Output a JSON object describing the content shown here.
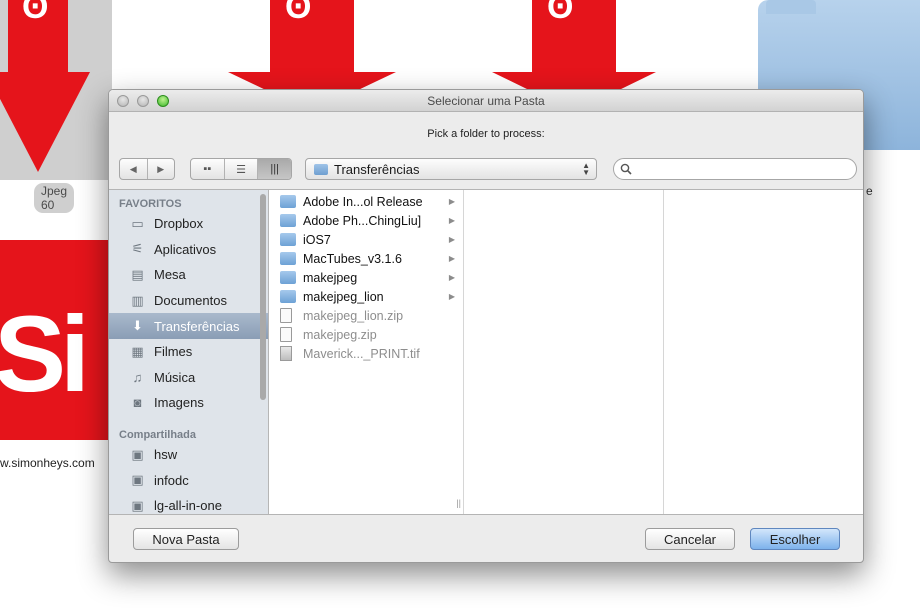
{
  "background": {
    "badge": "Jpeg 60",
    "url": "w.simonheys.com",
    "tile_text": "Si",
    "arrow_glyph": "ʘ",
    "stray_text": "e"
  },
  "dialog": {
    "title": "Selecionar uma Pasta",
    "prompt": "Pick a folder to process:",
    "path_popup": "Transferências",
    "search": {
      "value": "",
      "placeholder": ""
    },
    "view_buttons": [
      "icon-view",
      "list-view",
      "column-view"
    ],
    "sidebar": {
      "favorites_header": "FAVORITOS",
      "favorites": [
        {
          "label": "Dropbox",
          "icon": "folder-icon"
        },
        {
          "label": "Aplicativos",
          "icon": "applications-icon"
        },
        {
          "label": "Mesa",
          "icon": "desktop-icon"
        },
        {
          "label": "Documentos",
          "icon": "documents-icon"
        },
        {
          "label": "Transferências",
          "icon": "downloads-icon",
          "selected": true
        },
        {
          "label": "Filmes",
          "icon": "movies-icon"
        },
        {
          "label": "Música",
          "icon": "music-icon"
        },
        {
          "label": "Imagens",
          "icon": "pictures-icon"
        }
      ],
      "shared_header": "Compartilhada",
      "shared": [
        {
          "label": "hsw",
          "icon": "network-computer-icon"
        },
        {
          "label": "infodc",
          "icon": "network-computer-icon"
        },
        {
          "label": "lg-all-in-one",
          "icon": "network-computer-icon"
        }
      ]
    },
    "files": [
      {
        "name": "Adobe In...ol Release",
        "kind": "folder",
        "enabled": true
      },
      {
        "name": "Adobe Ph...ChingLiu]",
        "kind": "folder",
        "enabled": true
      },
      {
        "name": "iOS7",
        "kind": "folder",
        "enabled": true
      },
      {
        "name": "MacTubes_v3.1.6",
        "kind": "folder",
        "enabled": true
      },
      {
        "name": "makejpeg",
        "kind": "folder",
        "enabled": true
      },
      {
        "name": "makejpeg_lion",
        "kind": "folder",
        "enabled": true
      },
      {
        "name": "makejpeg_lion.zip",
        "kind": "zip",
        "enabled": false
      },
      {
        "name": "makejpeg.zip",
        "kind": "zip",
        "enabled": false
      },
      {
        "name": "Maverick..._PRINT.tif",
        "kind": "image",
        "enabled": false
      }
    ],
    "buttons": {
      "new_folder": "Nova Pasta",
      "cancel": "Cancelar",
      "choose": "Escolher"
    }
  }
}
